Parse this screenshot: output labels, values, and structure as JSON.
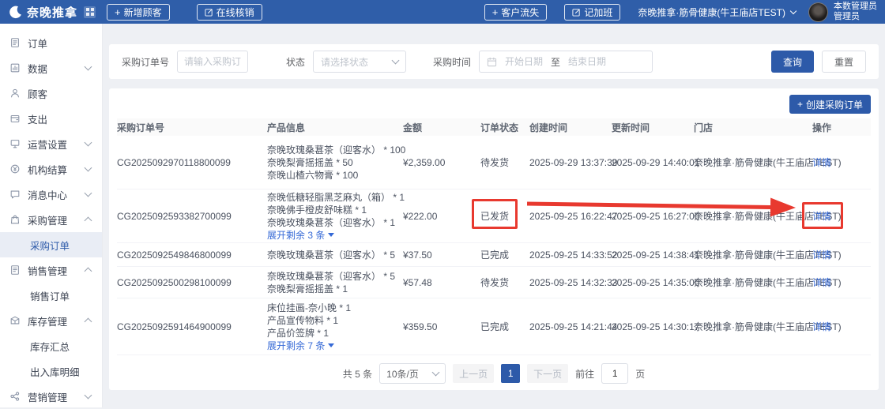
{
  "topbar": {
    "logo_text": "奈晚推拿",
    "new_customer": "新增顾客",
    "online_verify": "在线核销",
    "customer_churn": "客户流失",
    "log_overtime": "记加班",
    "store_name": "奈晚推拿·筋骨健康(牛王庙店TEST)",
    "user_name": "本数管理员",
    "user_role": "管理员"
  },
  "sidebar": {
    "items": [
      {
        "label": "订单"
      },
      {
        "label": "数据"
      },
      {
        "label": "顾客"
      },
      {
        "label": "支出"
      },
      {
        "label": "运营设置"
      },
      {
        "label": "机构结算"
      },
      {
        "label": "消息中心"
      },
      {
        "label": "采购管理",
        "children": [
          {
            "label": "采购订单",
            "active": true
          }
        ]
      },
      {
        "label": "销售管理",
        "children": [
          {
            "label": "销售订单"
          }
        ]
      },
      {
        "label": "库存管理",
        "children": [
          {
            "label": "库存汇总"
          },
          {
            "label": "出入库明细"
          }
        ]
      },
      {
        "label": "营销管理"
      }
    ]
  },
  "filters": {
    "order_no_label": "采购订单号",
    "order_no_placeholder": "请输入采购订单号",
    "status_label": "状态",
    "status_placeholder": "请选择状态",
    "time_label": "采购时间",
    "start_placeholder": "开始日期",
    "to_label": "至",
    "end_placeholder": "结束日期",
    "search_button": "查询",
    "reset_button": "重置"
  },
  "table": {
    "create_button": "创建采购订单",
    "action_label": "详情",
    "columns": [
      "采购订单号",
      "产品信息",
      "金额",
      "订单状态",
      "创建时间",
      "更新时间",
      "门店",
      "操作"
    ],
    "rows": [
      {
        "order_no": "CG2025092970118800099",
        "products": [
          "奈晚玫瑰桑葚茶（迎客水） * 100",
          "奈晚梨膏摇摇盖 * 50",
          "奈晚山楂六物膏 * 100"
        ],
        "amount": "¥2,359.00",
        "status": "待发货",
        "created": "2025-09-29 13:37:39",
        "updated": "2025-09-29 14:40:01",
        "store": "奈晚推拿·筋骨健康(牛王庙店TEST)"
      },
      {
        "order_no": "CG2025092593382700099",
        "products": [
          "奈晚低糖轻脂黑芝麻丸（箱） * 1",
          "奈晚佛手橙皮舒味糕 * 1",
          "奈晚玫瑰桑葚茶（迎客水） * 1"
        ],
        "expand": "展开剩余 3 条",
        "amount": "¥222.00",
        "status": "已发货",
        "created": "2025-09-25 16:22:47",
        "updated": "2025-09-25 16:27:00",
        "store": "奈晚推拿·筋骨健康(牛王庙店TEST)"
      },
      {
        "order_no": "CG2025092549846800099",
        "products": [
          "奈晚玫瑰桑葚茶（迎客水） * 5"
        ],
        "amount": "¥37.50",
        "status": "已完成",
        "created": "2025-09-25 14:33:52",
        "updated": "2025-09-25 14:38:41",
        "store": "奈晚推拿·筋骨健康(牛王庙店TEST)"
      },
      {
        "order_no": "CG2025092500298100099",
        "products": [
          "奈晚玫瑰桑葚茶（迎客水） * 5",
          "奈晚梨膏摇摇盖 * 1"
        ],
        "amount": "¥57.48",
        "status": "待发货",
        "created": "2025-09-25 14:32:33",
        "updated": "2025-09-25 14:35:00",
        "store": "奈晚推拿·筋骨健康(牛王庙店TEST)"
      },
      {
        "order_no": "CG2025092591464900099",
        "products": [
          "床位挂画-奈小晚 * 1",
          "产品宣传物料 * 1",
          "产品价签牌 * 1"
        ],
        "expand": "展开剩余 7 条",
        "amount": "¥359.50",
        "status": "已完成",
        "created": "2025-09-25 14:21:44",
        "updated": "2025-09-25 14:30:17",
        "store": "奈晚推拿·筋骨健康(牛王庙店TEST)"
      }
    ]
  },
  "pagination": {
    "total": "共 5 条",
    "page_size": "10条/页",
    "prev": "上一页",
    "current": "1",
    "next": "下一页",
    "jump_label": "前往",
    "jump_value": "1",
    "jump_suffix": "页"
  },
  "annotations": {
    "color": "#e8392f"
  }
}
